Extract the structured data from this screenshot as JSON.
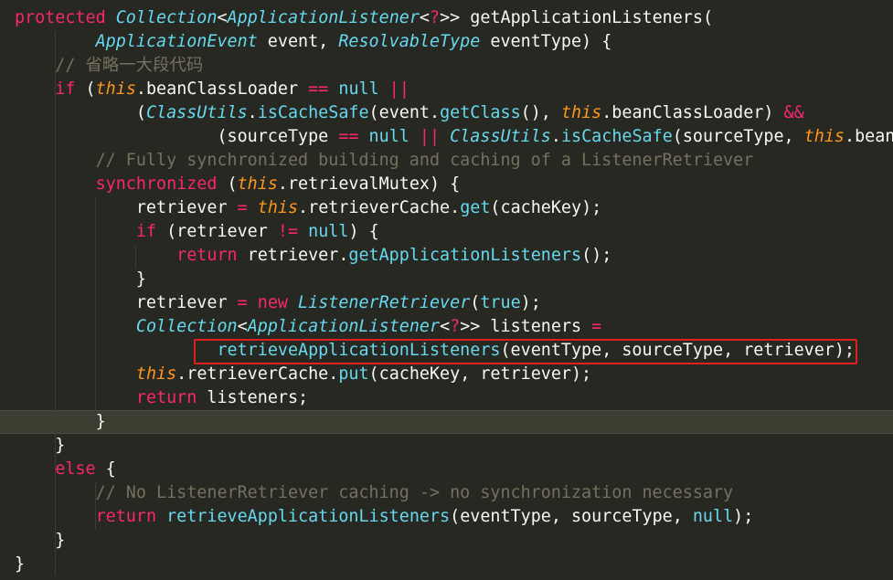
{
  "colors": {
    "background": "#272822",
    "keyword": "#f92672",
    "type": "#66d9ef",
    "this": "#fd971f",
    "comment": "#75715e",
    "text": "#f8f8f2",
    "highlight_box": "#e02020"
  },
  "code_lines": [
    [
      [
        "kw",
        "protected"
      ],
      [
        "p",
        " "
      ],
      [
        "type",
        "Collection"
      ],
      [
        "p",
        "<"
      ],
      [
        "type",
        "ApplicationListener"
      ],
      [
        "p",
        "<"
      ],
      [
        "op",
        "?"
      ],
      [
        "p",
        ">> getApplicationListeners("
      ]
    ],
    [
      [
        "p",
        "        "
      ],
      [
        "type",
        "ApplicationEvent"
      ],
      [
        "p",
        " event, "
      ],
      [
        "type",
        "ResolvableType"
      ],
      [
        "p",
        " eventType) {"
      ]
    ],
    [
      [
        "cmt",
        "    // 省略一大段代码"
      ]
    ],
    [
      [
        "p",
        "    "
      ],
      [
        "kw",
        "if"
      ],
      [
        "p",
        " ("
      ],
      [
        "this",
        "this"
      ],
      [
        "p",
        ".beanClassLoader "
      ],
      [
        "op",
        "=="
      ],
      [
        "p",
        " "
      ],
      [
        "const2",
        "null"
      ],
      [
        "p",
        " "
      ],
      [
        "op",
        "||"
      ]
    ],
    [
      [
        "p",
        "            ("
      ],
      [
        "type",
        "ClassUtils"
      ],
      [
        "p",
        "."
      ],
      [
        "method",
        "isCacheSafe"
      ],
      [
        "p",
        "(event."
      ],
      [
        "method",
        "getClass"
      ],
      [
        "p",
        "(), "
      ],
      [
        "this",
        "this"
      ],
      [
        "p",
        ".beanClassLoader) "
      ],
      [
        "op",
        "&&"
      ]
    ],
    [
      [
        "p",
        "                    (sourceType "
      ],
      [
        "op",
        "=="
      ],
      [
        "p",
        " "
      ],
      [
        "const2",
        "null"
      ],
      [
        "p",
        " "
      ],
      [
        "op",
        "||"
      ],
      [
        "p",
        " "
      ],
      [
        "type",
        "ClassUtils"
      ],
      [
        "p",
        "."
      ],
      [
        "method",
        "isCacheSafe"
      ],
      [
        "p",
        "(sourceType, "
      ],
      [
        "this",
        "this"
      ],
      [
        "p",
        ".bean"
      ]
    ],
    [
      [
        "cmt",
        "        // Fully synchronized building and caching of a ListenerRetriever"
      ]
    ],
    [
      [
        "p",
        "        "
      ],
      [
        "kw",
        "synchronized"
      ],
      [
        "p",
        " ("
      ],
      [
        "this",
        "this"
      ],
      [
        "p",
        ".retrievalMutex) {"
      ]
    ],
    [
      [
        "p",
        "            retriever "
      ],
      [
        "op",
        "="
      ],
      [
        "p",
        " "
      ],
      [
        "this",
        "this"
      ],
      [
        "p",
        ".retrieverCache."
      ],
      [
        "method",
        "get"
      ],
      [
        "p",
        "(cacheKey);"
      ]
    ],
    [
      [
        "p",
        "            "
      ],
      [
        "kw",
        "if"
      ],
      [
        "p",
        " (retriever "
      ],
      [
        "op",
        "!="
      ],
      [
        "p",
        " "
      ],
      [
        "const2",
        "null"
      ],
      [
        "p",
        ") {"
      ]
    ],
    [
      [
        "p",
        "                "
      ],
      [
        "kw",
        "return"
      ],
      [
        "p",
        " retriever."
      ],
      [
        "method",
        "getApplicationListeners"
      ],
      [
        "p",
        "();"
      ]
    ],
    [
      [
        "p",
        "            }"
      ]
    ],
    [
      [
        "p",
        "            retriever "
      ],
      [
        "op",
        "="
      ],
      [
        "p",
        " "
      ],
      [
        "kw",
        "new"
      ],
      [
        "p",
        " "
      ],
      [
        "type",
        "ListenerRetriever"
      ],
      [
        "p",
        "("
      ],
      [
        "const2",
        "true"
      ],
      [
        "p",
        ");"
      ]
    ],
    [
      [
        "p",
        "            "
      ],
      [
        "type",
        "Collection"
      ],
      [
        "p",
        "<"
      ],
      [
        "type",
        "ApplicationListener"
      ],
      [
        "p",
        "<"
      ],
      [
        "op",
        "?"
      ],
      [
        "p",
        ">> listeners "
      ],
      [
        "op",
        "="
      ]
    ],
    [
      [
        "p",
        "                    "
      ],
      [
        "method",
        "retrieveApplicationListeners"
      ],
      [
        "p",
        "(eventType, sourceType, retriever);"
      ]
    ],
    [
      [
        "p",
        "            "
      ],
      [
        "this",
        "this"
      ],
      [
        "p",
        ".retrieverCache."
      ],
      [
        "method",
        "put"
      ],
      [
        "p",
        "(cacheKey, retriever);"
      ]
    ],
    [
      [
        "p",
        "            "
      ],
      [
        "kw",
        "return"
      ],
      [
        "p",
        " listeners;"
      ]
    ],
    [
      [
        "p",
        "        }"
      ]
    ],
    [
      [
        "p",
        "    }"
      ]
    ],
    [
      [
        "p",
        "    "
      ],
      [
        "kw",
        "else"
      ],
      [
        "p",
        " {"
      ]
    ],
    [
      [
        "cmt",
        "        // No ListenerRetriever caching -> no synchronization necessary"
      ]
    ],
    [
      [
        "p",
        "        "
      ],
      [
        "kw",
        "return"
      ],
      [
        "p",
        " "
      ],
      [
        "method",
        "retrieveApplicationListeners"
      ],
      [
        "p",
        "(eventType, sourceType, "
      ],
      [
        "const2",
        "null"
      ],
      [
        "p",
        ");"
      ]
    ],
    [
      [
        "p",
        "    }"
      ]
    ],
    [
      [
        "p",
        "}"
      ]
    ]
  ]
}
